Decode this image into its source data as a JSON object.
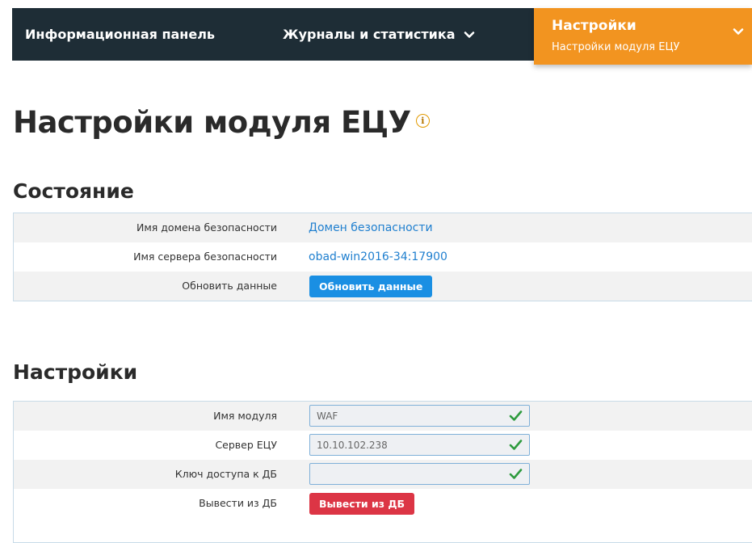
{
  "nav": {
    "items": [
      {
        "label": "Информационная панель"
      },
      {
        "label": "Журналы и статистика"
      }
    ],
    "active": {
      "title": "Настройки",
      "subtitle": "Настройки модуля ЕЦУ",
      "color": "#f29420"
    },
    "background": "#1e2d36"
  },
  "page": {
    "title": "Настройки модуля ЕЦУ",
    "info_icon_glyph": "i"
  },
  "status": {
    "heading": "Состояние",
    "rows": [
      {
        "label": "Имя домена безопасности",
        "value": "Домен безопасности"
      },
      {
        "label": "Имя сервера безопасности",
        "value": "obad-win2016-34:17900"
      },
      {
        "label": "Обновить данные",
        "button": "Обновить данные"
      }
    ]
  },
  "settings": {
    "heading": "Настройки",
    "rows": [
      {
        "label": "Имя модуля",
        "value": "WAF"
      },
      {
        "label": "Сервер ЕЦУ",
        "value": "10.10.102.238"
      },
      {
        "label": "Ключ доступа к ДБ",
        "value": ""
      },
      {
        "label": "Вывести из ДБ",
        "button": "Вывести из ДБ"
      }
    ]
  },
  "colors": {
    "accent": "#f29420",
    "link": "#1f7fcf",
    "primary_button": "#1a8fe3",
    "danger_button": "#dc3545",
    "valid_check": "#2e9b3e"
  }
}
